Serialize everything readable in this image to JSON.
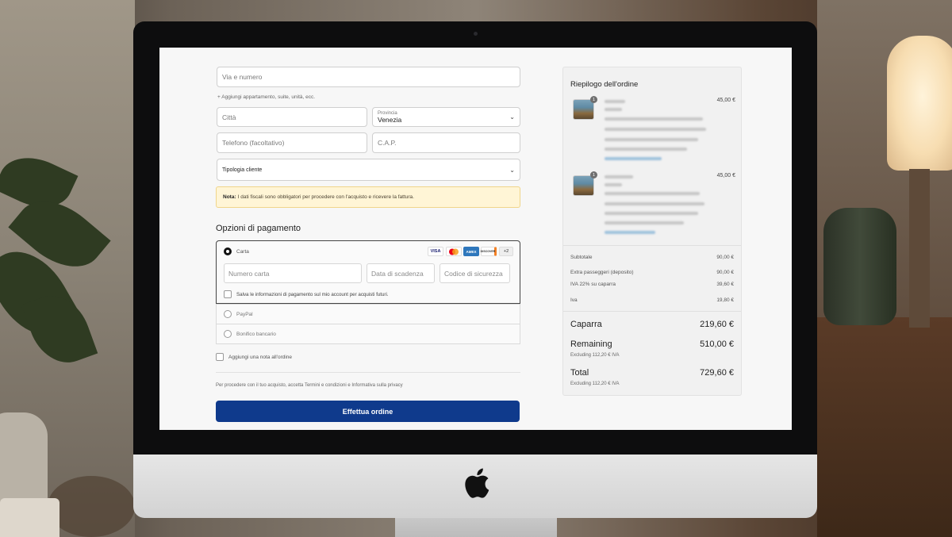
{
  "address": {
    "street_placeholder": "Via e numero",
    "add_apartment_link": "+ Aggiungi appartamento, suite, unità, ecc.",
    "city_placeholder": "Città",
    "province_label": "Provincia",
    "province_value": "Venezia",
    "phone_placeholder": "Telefono (facoltativo)",
    "zip_placeholder": "C.A.P.",
    "customer_type_label": "Tipologia cliente"
  },
  "notice": {
    "prefix": "Nota:",
    "text": "I dati fiscali sono obbligatori per procedere con l'acquisto e ricevere la fattura."
  },
  "payment": {
    "title": "Opzioni di pagamento",
    "card_label": "Carta",
    "brands": [
      "VISA",
      "MC",
      "AMEX",
      "DISCOVER",
      "+2"
    ],
    "card_number_placeholder": "Numero carta",
    "expiry_placeholder": "Data di scadenza",
    "cvc_placeholder": "Codice di sicurezza",
    "save_info_label": "Salva le informazioni di pagamento sul mio account per acquisti futuri.",
    "paypal_label": "PayPal",
    "bank_label": "Bonifico bancario"
  },
  "order_note_label": "Aggiungi una nota all'ordine",
  "terms_text": "Per procedere con il tuo acquisto, accetta Termini e condizioni e Informativa sulla privacy",
  "submit_label": "Effettua ordine",
  "summary": {
    "title": "Riepilogo dell'ordine",
    "items": [
      {
        "qty": "1",
        "price": "45,00 €"
      },
      {
        "qty": "1",
        "price": "45,00 €"
      }
    ],
    "subtotal_label": "Subtotale",
    "subtotal_value": "90,00 €",
    "extra_label": "Extra passeggeri (deposito)",
    "extra_value": "90,00 €",
    "vat_deposit_label": "IVA 22% su caparra",
    "vat_deposit_value": "39,60 €",
    "vat_label": "Iva",
    "vat_value": "19,80 €",
    "deposit_label": "Caparra",
    "deposit_value": "219,60 €",
    "remaining_label": "Remaining",
    "remaining_value": "510,00 €",
    "remaining_note": "Excluding 112,20 € IVA",
    "total_label": "Total",
    "total_value": "729,60 €",
    "total_note": "Excluding 112,20 € IVA"
  },
  "colors": {
    "primary_button": "#0f3a8c",
    "notice_bg": "#fff5d6"
  }
}
